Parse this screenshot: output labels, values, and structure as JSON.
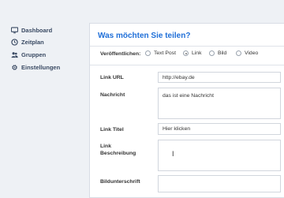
{
  "sidebar": {
    "items": [
      {
        "label": "Dashboard",
        "icon": "monitor-icon"
      },
      {
        "label": "Zeitplan",
        "icon": "clock-icon"
      },
      {
        "label": "Gruppen",
        "icon": "users-icon"
      },
      {
        "label": "Einstellungen",
        "icon": "gear-icon"
      }
    ]
  },
  "main": {
    "title": "Was möchten Sie teilen?",
    "publish_label": "Veröffentlichen:",
    "types": [
      {
        "label": "Text Post",
        "selected": false
      },
      {
        "label": "Link",
        "selected": true
      },
      {
        "label": "Bild",
        "selected": false
      },
      {
        "label": "Video",
        "selected": false
      }
    ],
    "fields": {
      "link_url": {
        "label": "Link URL",
        "value": "http://ebay.de"
      },
      "nachricht": {
        "label": "Nachricht",
        "value": "das ist eine Nachricht"
      },
      "link_titel": {
        "label": "Link Titel",
        "value": "Hier klicken"
      },
      "link_beschreibung": {
        "label": "Link Beschreibung",
        "value": ""
      },
      "bildunterschrift": {
        "label": "Bildunterschrift",
        "value": ""
      }
    }
  },
  "colors": {
    "accent": "#1f6fd8",
    "sidebar_text": "#3a4a63",
    "background": "#eef1f5"
  }
}
